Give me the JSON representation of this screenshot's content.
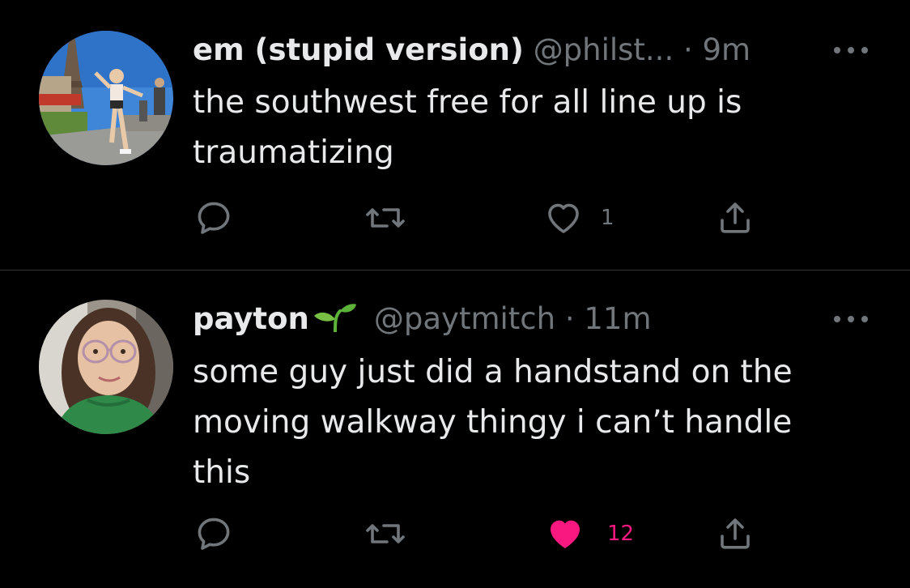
{
  "tweets": [
    {
      "display_name": "em (stupid version)",
      "handle": "@philst...",
      "separator": "·",
      "time": "9m",
      "text": "the southwest free for all line up is traumatizing",
      "actions": {
        "reply_count": "",
        "retweet_count": "",
        "like_count": "1",
        "liked": false
      }
    },
    {
      "display_name": "payton",
      "name_emoji": "seedling-icon",
      "handle": "@paytmitch",
      "separator": "·",
      "time": "11m",
      "text": "some guy just did a handstand on the moving walkway thingy i can’t handle this",
      "actions": {
        "reply_count": "",
        "retweet_count": "",
        "like_count": "12",
        "liked": true
      }
    }
  ],
  "colors": {
    "background": "#000000",
    "primary_text": "#e7e9ea",
    "secondary_text": "#71767b",
    "divider": "#2f3336",
    "like_active": "#f91880"
  }
}
